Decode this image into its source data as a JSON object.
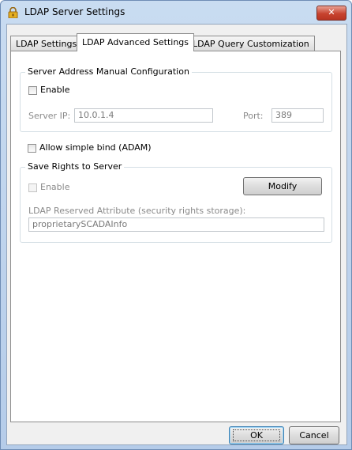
{
  "window": {
    "title": "LDAP Server Settings",
    "close_label": "✕"
  },
  "tabs": [
    {
      "label": "LDAP Settings",
      "active": false
    },
    {
      "label": "LDAP Advanced Settings",
      "active": true
    },
    {
      "label": "LDAP Query Customization",
      "active": false
    }
  ],
  "server_address": {
    "group_title": "Server Address Manual Configuration",
    "enable_label": "Enable",
    "enable_checked": false,
    "server_ip_label": "Server IP:",
    "server_ip_value": "10.0.1.4",
    "port_label": "Port:",
    "port_value": "389"
  },
  "simple_bind": {
    "label": "Allow simple bind (ADAM)",
    "checked": false
  },
  "save_rights": {
    "group_title": "Save Rights to Server",
    "enable_label": "Enable",
    "enable_checked": false,
    "modify_label": "Modify",
    "attribute_label": "LDAP Reserved Attribute (security rights storage):",
    "attribute_value": "proprietarySCADAInfo"
  },
  "footer": {
    "ok_label": "OK",
    "cancel_label": "Cancel"
  },
  "colors": {
    "title_bar": "#c9dcf1",
    "close_button": "#c7432f",
    "panel": "#ffffff"
  }
}
